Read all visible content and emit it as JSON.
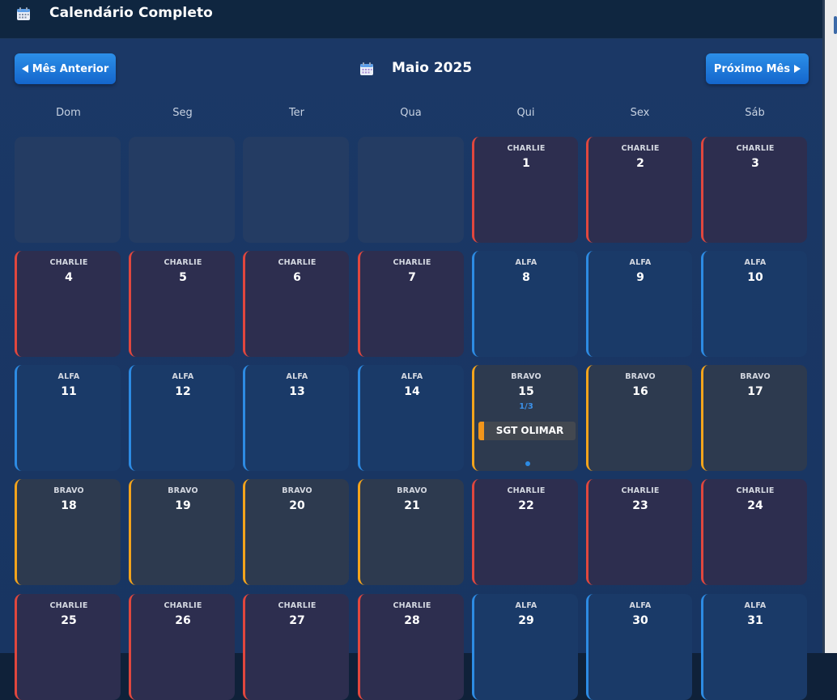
{
  "app": {
    "title": "Calendário Completo",
    "icon": "calendar-icon"
  },
  "nav": {
    "prev_label": "Mês Anterior",
    "next_label": "Próximo Mês",
    "month_label": "Maio 2025"
  },
  "weekdays": [
    "Dom",
    "Seg",
    "Ter",
    "Qua",
    "Qui",
    "Sex",
    "Sáb"
  ],
  "colors": {
    "charlie": "#e0473e",
    "alfa": "#2d8be3",
    "bravo": "#f3a41c"
  },
  "days": [
    {
      "day": "",
      "team": ""
    },
    {
      "day": "",
      "team": ""
    },
    {
      "day": "",
      "team": ""
    },
    {
      "day": "",
      "team": ""
    },
    {
      "day": "1",
      "team": "CHARLIE"
    },
    {
      "day": "2",
      "team": "CHARLIE"
    },
    {
      "day": "3",
      "team": "CHARLIE"
    },
    {
      "day": "4",
      "team": "CHARLIE"
    },
    {
      "day": "5",
      "team": "CHARLIE"
    },
    {
      "day": "6",
      "team": "CHARLIE"
    },
    {
      "day": "7",
      "team": "CHARLIE"
    },
    {
      "day": "8",
      "team": "ALFA"
    },
    {
      "day": "9",
      "team": "ALFA"
    },
    {
      "day": "10",
      "team": "ALFA"
    },
    {
      "day": "11",
      "team": "ALFA"
    },
    {
      "day": "12",
      "team": "ALFA"
    },
    {
      "day": "13",
      "team": "ALFA"
    },
    {
      "day": "14",
      "team": "ALFA"
    },
    {
      "day": "15",
      "team": "BRAVO",
      "count": "1/3",
      "person": "SGT OLIMAR"
    },
    {
      "day": "16",
      "team": "BRAVO"
    },
    {
      "day": "17",
      "team": "BRAVO"
    },
    {
      "day": "18",
      "team": "BRAVO"
    },
    {
      "day": "19",
      "team": "BRAVO"
    },
    {
      "day": "20",
      "team": "BRAVO"
    },
    {
      "day": "21",
      "team": "BRAVO"
    },
    {
      "day": "22",
      "team": "CHARLIE"
    },
    {
      "day": "23",
      "team": "CHARLIE"
    },
    {
      "day": "24",
      "team": "CHARLIE"
    },
    {
      "day": "25",
      "team": "CHARLIE"
    },
    {
      "day": "26",
      "team": "CHARLIE"
    },
    {
      "day": "27",
      "team": "CHARLIE"
    },
    {
      "day": "28",
      "team": "CHARLIE"
    },
    {
      "day": "29",
      "team": "ALFA"
    },
    {
      "day": "30",
      "team": "ALFA"
    },
    {
      "day": "31",
      "team": "ALFA"
    }
  ]
}
